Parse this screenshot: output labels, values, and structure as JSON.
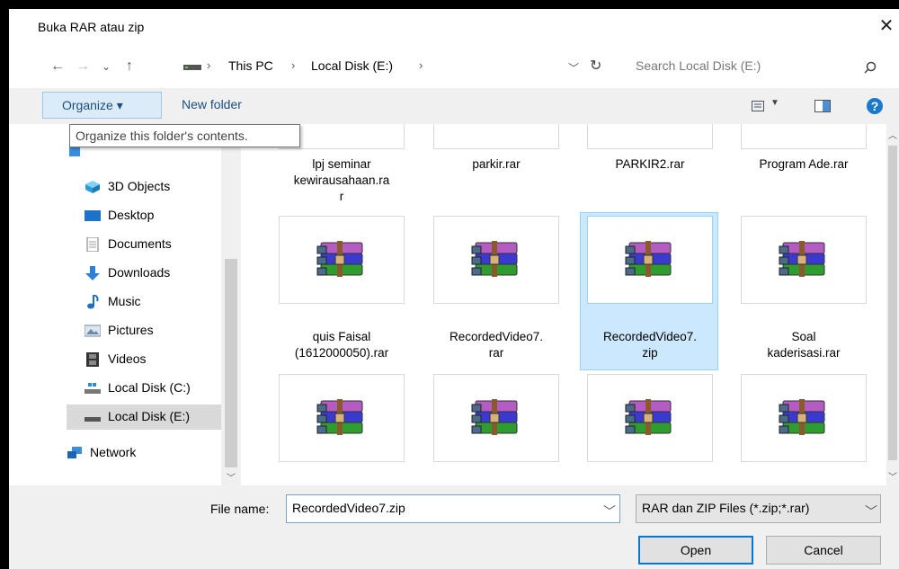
{
  "window": {
    "title": "Buka RAR atau zip",
    "close_glyph": "✕"
  },
  "addressbar": {
    "back_glyph": "←",
    "forward_glyph": "→",
    "recent_glyph": "⌄",
    "up_glyph": "↑",
    "crumbs": [
      "This PC",
      "Local Disk (E:)"
    ],
    "sep_glyph": "›",
    "refresh_glyph": "↻",
    "search_placeholder": "Search Local Disk (E:)"
  },
  "toolbar": {
    "organize_label": "Organize ▾",
    "new_folder_label": "New folder"
  },
  "tooltip": "Organize this folder's contents.",
  "nav": {
    "items": [
      {
        "label": "3D Objects",
        "icon": "cube-3d-icon"
      },
      {
        "label": "Desktop",
        "icon": "desktop-icon"
      },
      {
        "label": "Documents",
        "icon": "document-icon"
      },
      {
        "label": "Downloads",
        "icon": "download-icon"
      },
      {
        "label": "Music",
        "icon": "music-note-icon"
      },
      {
        "label": "Pictures",
        "icon": "pictures-icon"
      },
      {
        "label": "Videos",
        "icon": "video-film-icon"
      },
      {
        "label": "Local Disk (C:)",
        "icon": "drive-c-icon"
      },
      {
        "label": "Local Disk (E:)",
        "icon": "drive-e-icon"
      },
      {
        "label": "Network",
        "icon": "network-icon"
      }
    ],
    "selected_index": 8
  },
  "files": {
    "row0": [
      "lpj seminar kewirausahaan.rar",
      "parkir.rar",
      "PARKIR2.rar",
      "Program Ade.rar"
    ],
    "row1": [
      "quis Faisal (1612000050).rar",
      "RecordedVideo7.rar",
      "RecordedVideo7.zip",
      "Soal kaderisasi.rar"
    ],
    "row0_lines": [
      [
        "lpj seminar",
        "kewirausahaan.ra",
        "r"
      ],
      [
        "parkir.rar"
      ],
      [
        "PARKIR2.rar"
      ],
      [
        "Program Ade.rar"
      ]
    ],
    "row1_lines": [
      [
        "quis Faisal",
        "(1612000050).rar"
      ],
      [
        "RecordedVideo7.",
        "rar"
      ],
      [
        "RecordedVideo7.",
        "zip"
      ],
      [
        "Soal",
        "kaderisasi.rar"
      ]
    ],
    "selected": "RecordedVideo7.zip",
    "icon": "winrar-archive-icon"
  },
  "bottom": {
    "filename_label": "File name:",
    "filename_value": "RecordedVideo7.zip",
    "filetype_value": "RAR dan ZIP Files (*.zip;*.rar)",
    "open_label": "Open",
    "cancel_label": "Cancel"
  },
  "colors": {
    "accent": "#0078d7",
    "selection": "#cce8ff",
    "help": "#1979ca"
  }
}
